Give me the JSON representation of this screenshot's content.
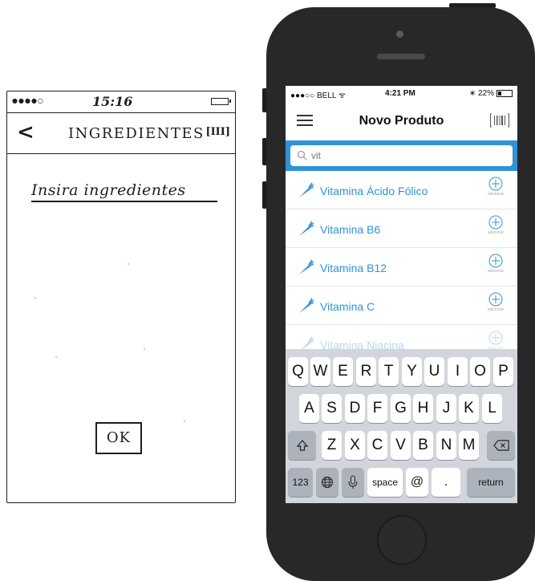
{
  "sketch": {
    "status_dots": "●●●●○",
    "time": "15:16",
    "back": "<",
    "title": "INGREDIENTES",
    "scan": "[III]",
    "input_placeholder": "Insira ingredientes",
    "ok": "OK"
  },
  "phone": {
    "status": {
      "carrier": "●●●○○ BELL ᯤ",
      "time": "4:21 PM",
      "battery": "∗ 22%"
    },
    "nav": {
      "title": "Novo Produto"
    },
    "search": {
      "value": "vit"
    },
    "results": [
      {
        "name": "Vitamina Ácido Fólico",
        "action": "adicionar"
      },
      {
        "name": "Vitamina B6",
        "action": "adicionar"
      },
      {
        "name": "Vitamina B12",
        "action": "adicionar"
      },
      {
        "name": "Vitamina C",
        "action": "adicionar"
      },
      {
        "name": "Vitamina Niacina",
        "action": "adicionar"
      }
    ],
    "keyboard": {
      "row1": [
        "Q",
        "W",
        "E",
        "R",
        "T",
        "Y",
        "U",
        "I",
        "O",
        "P"
      ],
      "row2": [
        "A",
        "S",
        "D",
        "F",
        "G",
        "H",
        "J",
        "K",
        "L"
      ],
      "row3": [
        "Z",
        "X",
        "C",
        "V",
        "B",
        "N",
        "M"
      ],
      "numbers": "123",
      "space": "space",
      "at": "@",
      "period": ".",
      "return": "return"
    },
    "colors": {
      "accent": "#2f93d6",
      "keyboard_bg": "#d2d5db"
    }
  }
}
